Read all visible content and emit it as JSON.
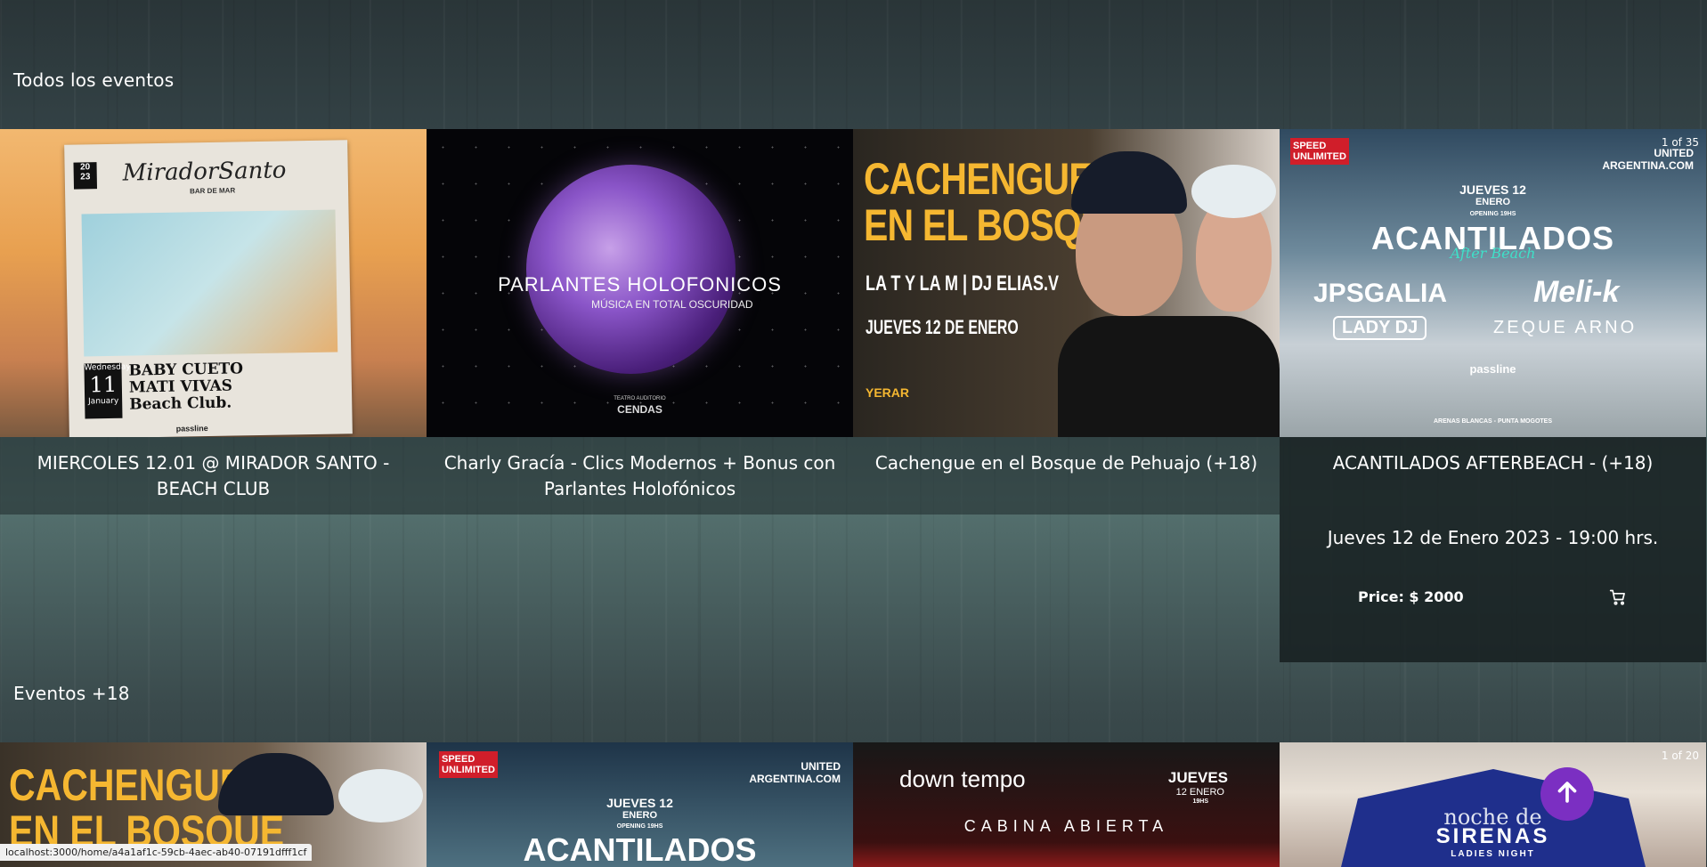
{
  "sections": {
    "all_events": {
      "title": "Todos los eventos",
      "counter": "1 of 35",
      "cards": [
        {
          "title": "MIERCOLES 12.01 @ MIRADOR SANTO - BEACH CLUB",
          "poster": {
            "brand": "MiradorSanto",
            "subtitle": "BAR DE MAR",
            "year": "20\n23",
            "day": "Wednesday",
            "date": "11",
            "month": "January",
            "lines": [
              "BABY CUETO",
              "MATI VIVAS",
              "Beach Club."
            ],
            "sponsor": "passline"
          }
        },
        {
          "title": "Charly Gracía - Clics Modernos + Bonus con Parlantes Holofónicos",
          "poster": {
            "headline": "PARLANTES HOLOFONICOS",
            "tagline": "MÚSICA EN TOTAL OSCURIDAD",
            "venue": "CENDAS",
            "venue_label": "TEATRO AUDITORIO"
          }
        },
        {
          "title": "Cachengue en el Bosque de Pehuajo (+18)",
          "poster": {
            "headline_1": "CACHENGUE",
            "headline_2": "EN EL BOSQUE",
            "lineup": "LA T Y LA M | DJ ELIAS.V",
            "date": "JUEVES 12 DE ENERO",
            "sponsor": "YERAR"
          }
        },
        {
          "title": "ACANTILADOS AFTERBEACH - (+18)",
          "poster": {
            "badge": "SPEED UNLIMITED",
            "radio": "UNITED ARGENTINA.COM",
            "day": "JUEVES 12",
            "month": "ENERO",
            "opening": "OPENING 19HS",
            "headline": "ACANTILADOS",
            "script": "After Beach",
            "artists_1": "JPSGALIA",
            "artists_2": "Meli-k",
            "artists_3": "LADY DJ",
            "artists_4": "ZEQUE ARNO",
            "sponsor": "passline",
            "footer": "ARENAS BLANCAS - PUNTA MOGOTES"
          },
          "date": "Jueves 12 de Enero 2023 - 19:00 hrs.",
          "price": "Price: $ 2000"
        }
      ]
    },
    "adult_events": {
      "title": "Eventos +18",
      "counter": "1 of 20",
      "cards": [
        {
          "poster": {
            "headline_1": "CACHENGUE",
            "headline_2": "EN EL BOSQUE"
          }
        },
        {
          "poster": {
            "badge": "SPEED UNLIMITED",
            "radio": "UNITED ARGENTINA.COM",
            "day": "JUEVES 12",
            "month": "ENERO",
            "opening": "OPENING 19HS",
            "headline": "ACANTILADOS"
          }
        },
        {
          "poster": {
            "brand": "down tempo",
            "day": "JUEVES",
            "date": "12 ENERO",
            "hour": "19HS",
            "headline": "CABINA ABIERTA"
          }
        },
        {
          "poster": {
            "line_1": "noche de",
            "line_2": "SIRENAS",
            "line_3": "LADIES NIGHT"
          }
        }
      ]
    }
  },
  "status_bar": "localhost:3000/home/a4a1af1c-59cb-4aec-ab40-07191dfff1cf",
  "icons": {
    "cart": "cart-icon",
    "scroll_top": "arrow-up-icon"
  },
  "colors": {
    "accent": "#7b2fc2"
  }
}
